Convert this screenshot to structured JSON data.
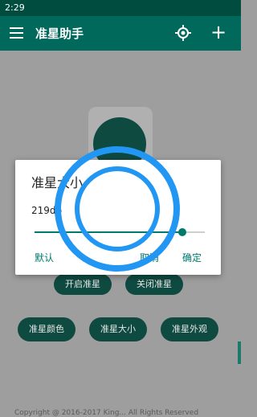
{
  "status_bar": {
    "time": "2:29"
  },
  "app_bar": {
    "title": "准星助手",
    "icons": [
      "menu-icon",
      "target-icon",
      "add-icon"
    ]
  },
  "background": {
    "buttons": {
      "open": "开启准星",
      "close": "关闭准星",
      "color": "准星颜色",
      "size": "准星大小",
      "look": "准星外观"
    },
    "footer": "Copyright @ 2016-2017 King... All Rights Reserved"
  },
  "dialog": {
    "title": "准星大小",
    "value_text": "219dp",
    "slider_fraction": 0.87,
    "buttons": {
      "default": "默认",
      "cancel": "取消",
      "ok": "确定"
    }
  },
  "colors": {
    "primary": "#00695c",
    "primary_dark": "#004d40",
    "accent": "#00796b",
    "crosshair": "#2196f3"
  }
}
